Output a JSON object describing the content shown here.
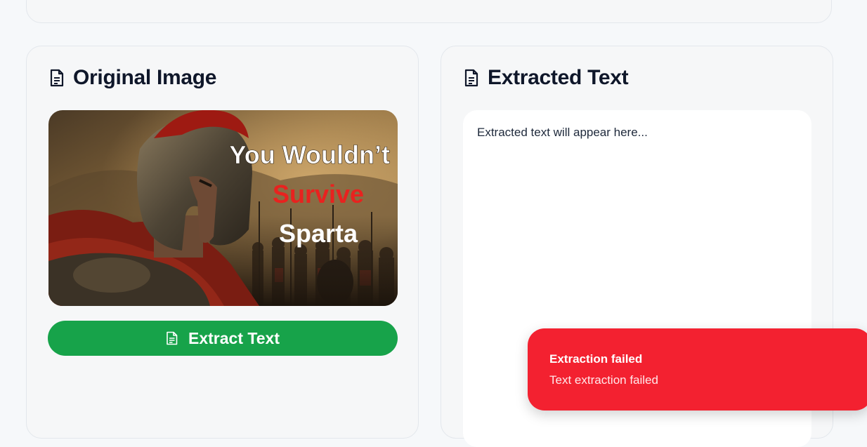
{
  "original_panel": {
    "title": "Original Image",
    "title_icon": "document-icon",
    "image": {
      "overlay_lines": [
        "You Wouldn’t",
        "Survive",
        "Sparta"
      ],
      "overlay_colors": [
        "#ffffff",
        "#e8221f",
        "#ffffff"
      ]
    },
    "extract_button": {
      "label": "Extract Text",
      "icon": "document-icon",
      "color": "#17a34a"
    }
  },
  "extracted_panel": {
    "title": "Extracted Text",
    "title_icon": "document-icon",
    "placeholder": "Extracted text will appear here..."
  },
  "toast": {
    "title": "Extraction failed",
    "message": "Text extraction failed",
    "color": "#f32130"
  }
}
